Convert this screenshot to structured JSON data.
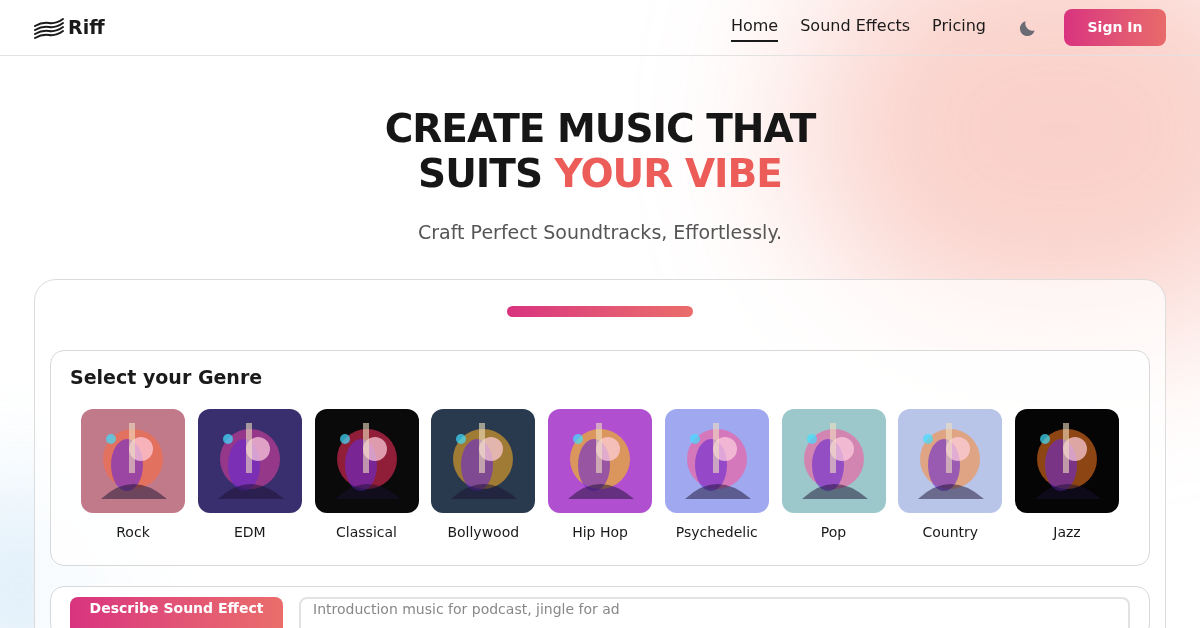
{
  "brand": {
    "name": "Riff"
  },
  "nav": [
    {
      "label": "Home",
      "selected": true
    },
    {
      "label": "Sound Effects",
      "selected": false
    },
    {
      "label": "Pricing",
      "selected": false
    }
  ],
  "sign_in": "Sign In",
  "hero": {
    "title_line1": "CREATE MUSIC THAT",
    "title_line2_plain": "SUITS ",
    "title_line2_accent": "YOUR VIBE",
    "subtitle": "Craft Perfect Soundtracks, Effortlessly."
  },
  "genre_panel": {
    "title": "Select your Genre",
    "genres": [
      {
        "label": "Rock",
        "color": "#c07a8a"
      },
      {
        "label": "EDM",
        "color": "#3a2f6e"
      },
      {
        "label": "Classical",
        "color": "#0a0a0a"
      },
      {
        "label": "Bollywood",
        "color": "#2a3a4e"
      },
      {
        "label": "Hip Hop",
        "color": "#b050d0"
      },
      {
        "label": "Psychedelic",
        "color": "#a0a8f0"
      },
      {
        "label": "Pop",
        "color": "#9cc8cc"
      },
      {
        "label": "Country",
        "color": "#b8c4e8"
      },
      {
        "label": "Jazz",
        "color": "#050505"
      }
    ]
  },
  "describe": {
    "button": "Describe Sound Effect",
    "placeholder": "Introduction music for podcast, jingle for ad"
  }
}
